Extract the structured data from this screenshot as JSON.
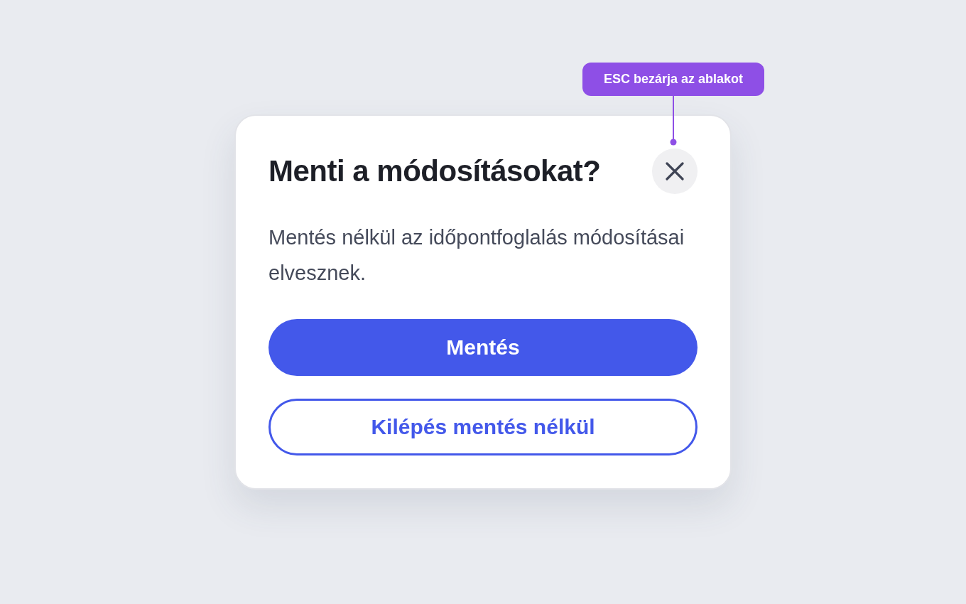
{
  "dialog": {
    "title": "Menti a módosításokat?",
    "message": "Mentés nélkül az időpontfoglalás módosításai elvesznek.",
    "buttons": [
      {
        "label": "Mentés",
        "kind": "primary"
      },
      {
        "label": "Kilépés mentés nélkül",
        "kind": "outline"
      }
    ]
  },
  "annotation": {
    "text": "ESC bezárja az ablakot",
    "color": "#8e4fe6"
  }
}
